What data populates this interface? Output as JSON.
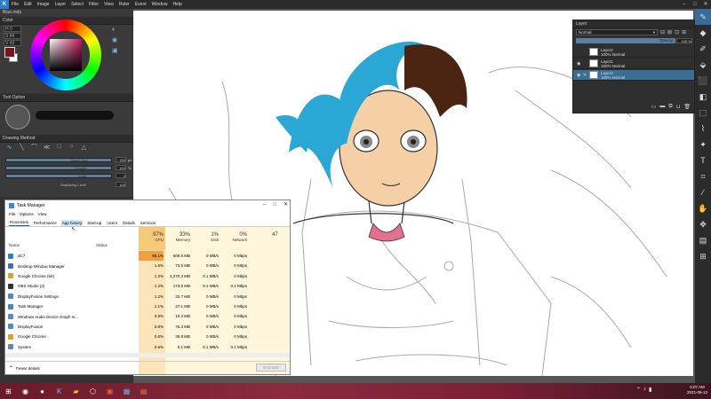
{
  "app": {
    "menu": [
      "File",
      "Edit",
      "Image",
      "Layer",
      "Select",
      "Filter",
      "View",
      "Ruler",
      "Event",
      "Window",
      "Help"
    ],
    "doc_tab": "Blue.mdp"
  },
  "color_panel": {
    "title": "Color",
    "hsv": [
      {
        "label": "H",
        "value": "0"
      },
      {
        "label": "S",
        "value": "84"
      },
      {
        "label": "V",
        "value": "43"
      }
    ],
    "main_color": "#7a1020"
  },
  "tool_option": {
    "title": "Tool Option"
  },
  "drawing_method": {
    "title": "Drawing Method",
    "sliders": [
      {
        "label": "Brush Size",
        "value": "150",
        "unit": "px"
      },
      {
        "label": "Opacity",
        "value": "100",
        "unit": "%"
      },
      {
        "label": "AntiA",
        "value": "3"
      },
      {
        "label": "Stabilizing Level",
        "value": "100"
      }
    ]
  },
  "layers": {
    "title": "Layer",
    "blend_mode": "Normal",
    "opacity_label": "Opacity",
    "opacity_value": "100 %",
    "items": [
      {
        "name": "Layer2",
        "detail": "100% Normal",
        "selected": false
      },
      {
        "name": "Layer1",
        "detail": "100% Normal",
        "selected": false
      },
      {
        "name": "Layer3",
        "detail": "100% Normal",
        "selected": true
      }
    ]
  },
  "task_manager": {
    "title": "Task Manager",
    "menu": [
      "File",
      "Options",
      "View"
    ],
    "tabs": [
      "Processes",
      "Performance",
      "App history",
      "Start-up",
      "Users",
      "Details",
      "Services"
    ],
    "active_tab": "Processes",
    "hover_tab": "App history",
    "columns": {
      "name": "Name",
      "status": "Status",
      "cpu": {
        "pct": "97%",
        "label": "CPU"
      },
      "memory": {
        "pct": "33%",
        "label": "Memory"
      },
      "disk": {
        "pct": "1%",
        "label": "Disk"
      },
      "network": {
        "pct": "0%",
        "label": "Network"
      },
      "extra_pct": "47"
    },
    "rows": [
      {
        "name": "dC7",
        "cpu": "85.1%",
        "mem": "609.5 MB",
        "disk": "0 MB/s",
        "net": "0 Mbps",
        "icon": "#2f7dc4"
      },
      {
        "name": "Desktop Window Manager",
        "cpu": "1.6%",
        "mem": "73.6 MB",
        "disk": "0 MB/s",
        "net": "0 Mbps",
        "icon": "#3b6fb6"
      },
      {
        "name": "Google Chrome (64)",
        "cpu": "1.2%",
        "mem": "3,270.3 MB",
        "disk": "0.1 MB/s",
        "net": "0 Mbps",
        "icon": "#e0a020"
      },
      {
        "name": "OBS Studio (2)",
        "cpu": "1.2%",
        "mem": "173.6 MB",
        "disk": "0.1 MB/s",
        "net": "0.1 Mbps",
        "icon": "#333333"
      },
      {
        "name": "DisplayFusion Settings",
        "cpu": "1.2%",
        "mem": "32.7 MB",
        "disk": "0 MB/s",
        "net": "0 Mbps",
        "icon": "#4a8ad0"
      },
      {
        "name": "Task Manager",
        "cpu": "1.1%",
        "mem": "27.1 MB",
        "disk": "0 MB/s",
        "net": "0 Mbps",
        "icon": "#3a8ad0"
      },
      {
        "name": "Windows Audio Device Graph Is...",
        "cpu": "0.8%",
        "mem": "10.3 MB",
        "disk": "0 MB/s",
        "net": "0 Mbps",
        "icon": "#5a8ac0"
      },
      {
        "name": "DisplayFusion",
        "cpu": "0.8%",
        "mem": "75.3 MB",
        "disk": "0 MB/s",
        "net": "0 Mbps",
        "icon": "#4a8ad0"
      },
      {
        "name": "Google Chrome",
        "cpu": "0.6%",
        "mem": "35.8 MB",
        "disk": "0 MB/s",
        "net": "0 Mbps",
        "icon": "#e0a020"
      },
      {
        "name": "System",
        "cpu": "0.6%",
        "mem": "0.1 MB",
        "disk": "0.1 MB/s",
        "net": "0.1 Mbps",
        "icon": "#5a8ac0"
      }
    ],
    "fewer_details": "Fewer details",
    "end_task": "End task"
  },
  "clock": {
    "time": "5:07 AM",
    "date": "2021-06-13"
  }
}
